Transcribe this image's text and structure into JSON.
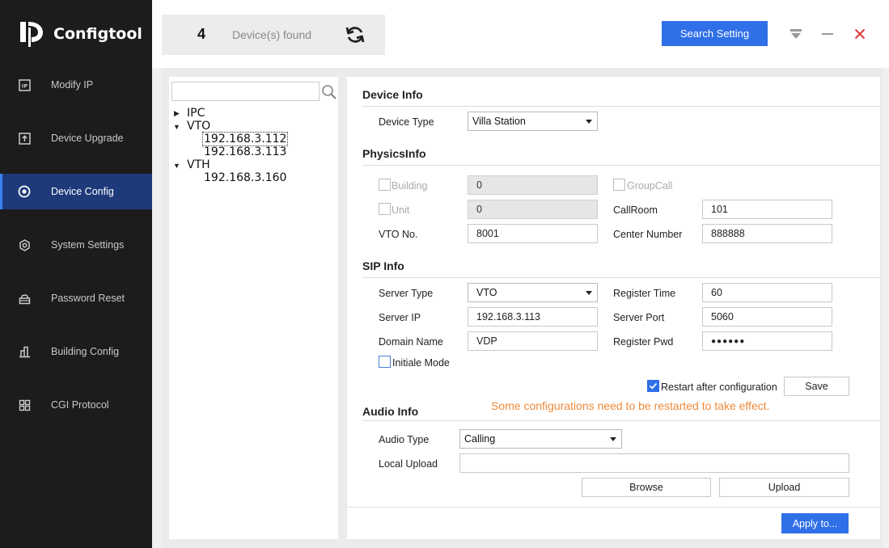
{
  "app": {
    "name": "Configtool"
  },
  "sidebar": {
    "items": [
      {
        "label": "Modify IP",
        "icon": "ip-icon"
      },
      {
        "label": "Device Upgrade",
        "icon": "upload-icon"
      },
      {
        "label": "Device Config",
        "icon": "target-icon",
        "active": true
      },
      {
        "label": "System Settings",
        "icon": "gear-icon"
      },
      {
        "label": "Password Reset",
        "icon": "lock-icon"
      },
      {
        "label": "Building Config",
        "icon": "building-icon"
      },
      {
        "label": "CGI Protocol",
        "icon": "grid-icon"
      }
    ]
  },
  "header": {
    "device_count": "4",
    "devices_found_label": "Device(s) found",
    "search_setting_label": "Search Setting"
  },
  "tree": {
    "search_placeholder": "",
    "groups": [
      {
        "label": "IPC",
        "expanded": false,
        "children": []
      },
      {
        "label": "VTO",
        "expanded": true,
        "children": [
          "192.168.3.112",
          "192.168.3.113"
        ]
      },
      {
        "label": "VTH",
        "expanded": true,
        "children": [
          "192.168.3.160"
        ]
      }
    ],
    "selected": "192.168.3.112"
  },
  "device_info": {
    "title": "Device Info",
    "device_type_label": "Device Type",
    "device_type_value": "Villa Station"
  },
  "physics_info": {
    "title": "PhysicsInfo",
    "building_label": "Building",
    "building_value": "0",
    "group_call_label": "GroupCall",
    "unit_label": "Unit",
    "unit_value": "0",
    "call_room_label": "CallRoom",
    "call_room_value": "101",
    "vto_no_label": "VTO No.",
    "vto_no_value": "8001",
    "center_number_label": "Center Number",
    "center_number_value": "888888"
  },
  "sip_info": {
    "title": "SIP Info",
    "server_type_label": "Server Type",
    "server_type_value": "VTO",
    "register_time_label": "Register Time",
    "register_time_value": "60",
    "server_ip_label": "Server IP",
    "server_ip_value": "192.168.3.113",
    "server_port_label": "Server Port",
    "server_port_value": "5060",
    "domain_name_label": "Domain Name",
    "domain_name_value": "VDP",
    "register_pwd_label": "Register Pwd",
    "register_pwd_value": "●●●●●●",
    "initiale_mode_label": "Initiale Mode",
    "restart_label": "Restart after configuration",
    "save_label": "Save",
    "warning": "Some configurations need to be restarted to take effect."
  },
  "audio_info": {
    "title": "Audio Info",
    "audio_type_label": "Audio Type",
    "audio_type_value": "Calling",
    "local_upload_label": "Local Upload",
    "local_upload_value": "",
    "browse_label": "Browse",
    "upload_label": "Upload"
  },
  "footer": {
    "apply_label": "Apply to..."
  },
  "colors": {
    "accent": "#2f6fe8",
    "warning": "#f08a3a",
    "close": "#e03c3c",
    "sidebar_bg": "#1c1c1c",
    "active_bg": "#1e3a7a"
  }
}
